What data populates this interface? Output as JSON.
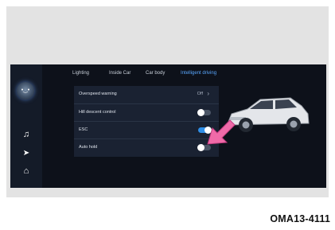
{
  "tabs": [
    "Lighting",
    "Inside Car",
    "Car body",
    "Intelligent driving"
  ],
  "active_tab_index": 3,
  "settings": [
    {
      "label": "Overspeed warning",
      "value": "Off",
      "control": "chevron"
    },
    {
      "label": "Hill descent control",
      "state": "off",
      "control": "toggle"
    },
    {
      "label": "ESC",
      "state": "on",
      "control": "toggle"
    },
    {
      "label": "Auto hold",
      "state": "off",
      "control": "toggle"
    }
  ],
  "left_rail_icons": [
    "home-icon",
    "music-icon",
    "navigation-icon",
    "lock-icon"
  ],
  "colors": {
    "screen_bg": "#0d111a",
    "panel_bg": "#1a2232",
    "accent": "#5aa8ff",
    "toggle_on": "#2f8fe8",
    "arrow": "#f06aa8"
  },
  "caption": "OMA13-4111"
}
